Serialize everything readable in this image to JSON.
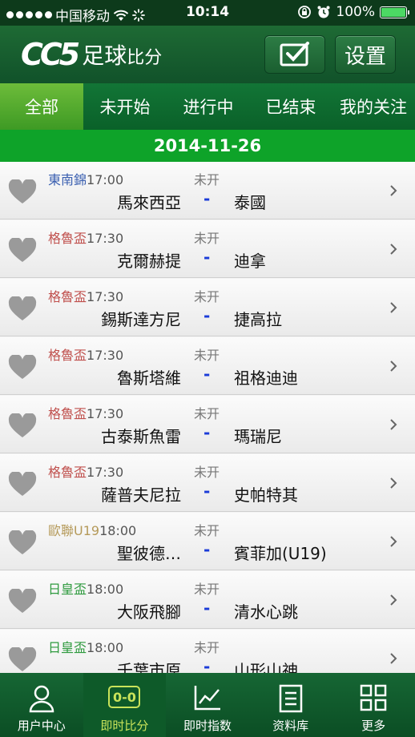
{
  "status_bar": {
    "carrier": "中国移动",
    "time": "10:14",
    "battery": "100%"
  },
  "header": {
    "logo_mark": "CC5",
    "logo_text_a": "足球",
    "logo_text_b": "比分",
    "settings_label": "设置"
  },
  "tabs": [
    {
      "label": "全部"
    },
    {
      "label": "未开始"
    },
    {
      "label": "进行中"
    },
    {
      "label": "已结束"
    },
    {
      "label": "我的关注"
    }
  ],
  "date": "2014-11-26",
  "colors": {
    "league_dongnanjin": "#3a5fb0",
    "league_geluzhan": "#c0504d",
    "league_oulian": "#b59a5a",
    "league_rihuangbei": "#2e9a3e"
  },
  "matches": [
    {
      "league": "東南錦",
      "time": "17:00",
      "status": "未开",
      "home": "馬來西亞",
      "dash": "-",
      "away": "泰國"
    },
    {
      "league": "格魯盃",
      "time": "17:30",
      "status": "未开",
      "home": "克爾赫提",
      "dash": "-",
      "away": "迪拿"
    },
    {
      "league": "格魯盃",
      "time": "17:30",
      "status": "未开",
      "home": "錫斯達方尼",
      "dash": "-",
      "away": "捷高拉"
    },
    {
      "league": "格魯盃",
      "time": "17:30",
      "status": "未开",
      "home": "魯斯塔維",
      "dash": "-",
      "away": "祖格迪迪"
    },
    {
      "league": "格魯盃",
      "time": "17:30",
      "status": "未开",
      "home": "古泰斯魚雷",
      "dash": "-",
      "away": "瑪瑞尼"
    },
    {
      "league": "格魯盃",
      "time": "17:30",
      "status": "未开",
      "home": "薩普夫尼拉",
      "dash": "-",
      "away": "史帕特其"
    },
    {
      "league": "歐聯U19",
      "time": "18:00",
      "status": "未开",
      "home": "聖彼德…",
      "dash": "-",
      "away": "賓菲加(U19)"
    },
    {
      "league": "日皇盃",
      "time": "18:00",
      "status": "未开",
      "home": "大阪飛腳",
      "dash": "-",
      "away": "清水心跳"
    },
    {
      "league": "日皇盃",
      "time": "18:00",
      "status": "未开",
      "home": "千葉市原",
      "dash": "-",
      "away": "山形山神"
    }
  ],
  "bottom_nav": [
    {
      "label": "用户中心",
      "icon": "user-icon"
    },
    {
      "label": "即时比分",
      "icon": "score-icon",
      "icon_text": "0-0"
    },
    {
      "label": "即时指数",
      "icon": "chart-icon"
    },
    {
      "label": "资料库",
      "icon": "document-icon"
    },
    {
      "label": "更多",
      "icon": "grid-icon"
    }
  ]
}
